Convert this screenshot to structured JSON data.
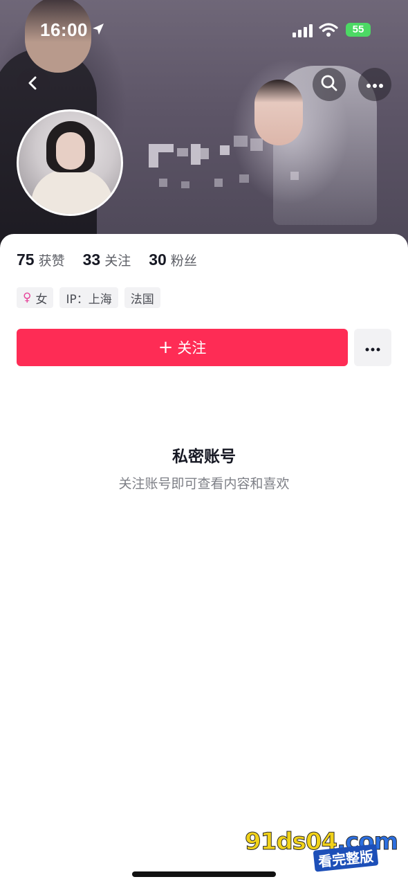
{
  "status_bar": {
    "time": "16:00",
    "battery": "55"
  },
  "header": {
    "back_icon": "chevron-left-icon",
    "search_icon": "search-icon",
    "more_icon": "more-horizontal-icon"
  },
  "stats": [
    {
      "num": "75",
      "label": "获赞"
    },
    {
      "num": "33",
      "label": "关注"
    },
    {
      "num": "30",
      "label": "粉丝"
    }
  ],
  "tags": {
    "gender_symbol": "♀",
    "gender": "女",
    "ip": "IP：上海",
    "location": "法国"
  },
  "actions": {
    "follow_plus": "+",
    "follow_label": "关注",
    "more_icon": "more-horizontal-icon"
  },
  "private": {
    "title": "私密账号",
    "subtitle": "关注账号即可查看内容和喜欢"
  },
  "watermark": {
    "site_main": "91ds04",
    "site_tld": ".com",
    "cta": "看完整版"
  },
  "colors": {
    "accent": "#fe2c55",
    "gender": "#e6439a",
    "battery": "#4cd964"
  }
}
